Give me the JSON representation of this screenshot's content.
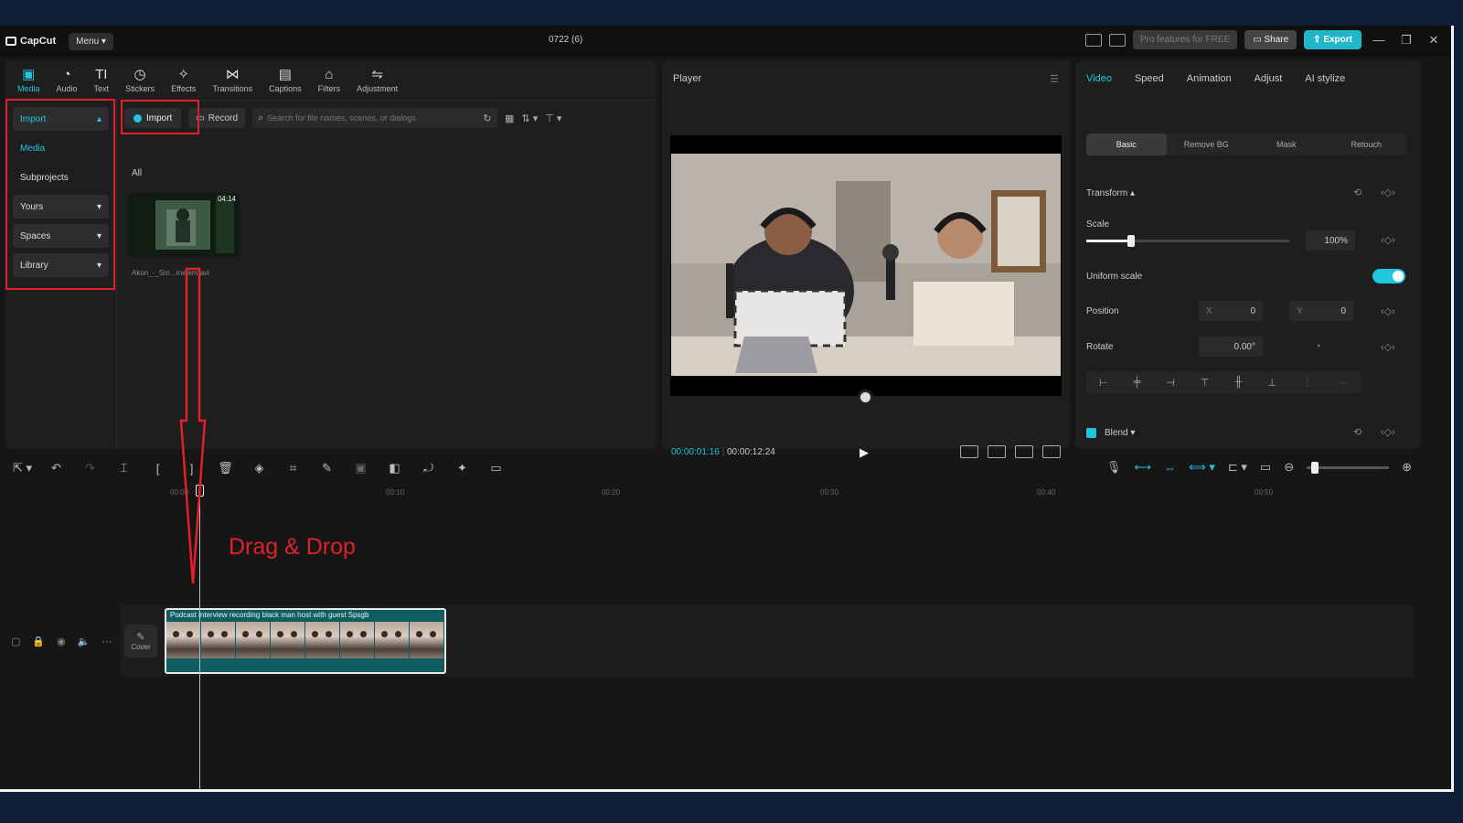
{
  "app": {
    "name": "CapCut",
    "menu_label": "Menu",
    "project_title": "0722 (6)"
  },
  "titlebar": {
    "pro_label": "Pro features for FREE",
    "share_label": "Share",
    "export_label": "Export",
    "minimize": "—",
    "maximize": "❐",
    "close": "✕"
  },
  "media_tabs": [
    {
      "label": "Media",
      "icon": "▣"
    },
    {
      "label": "Audio",
      "icon": "◔"
    },
    {
      "label": "Text",
      "icon": "TI"
    },
    {
      "label": "Stickers",
      "icon": "◷"
    },
    {
      "label": "Effects",
      "icon": "✧"
    },
    {
      "label": "Transitions",
      "icon": "⋈"
    },
    {
      "label": "Captions",
      "icon": "▤"
    },
    {
      "label": "Filters",
      "icon": "⌂"
    },
    {
      "label": "Adjustment",
      "icon": "⇋"
    }
  ],
  "sidebar": {
    "import": "Import",
    "media": "Media",
    "subprojects": "Subprojects",
    "yours": "Yours",
    "spaces": "Spaces",
    "library": "Library"
  },
  "media_toolbar": {
    "import_label": "Import",
    "record_label": "Record",
    "search_placeholder": "Search for file names, scenes, or dialogs"
  },
  "media_list": {
    "filter_label": "All",
    "items": [
      {
        "name": "Akon_-_Sm...minem.avi",
        "duration": "04:14"
      }
    ]
  },
  "player": {
    "title": "Player",
    "current_time": "00:00:01:16",
    "total_time": "00:00:12:24"
  },
  "properties": {
    "tabs": [
      "Video",
      "Speed",
      "Animation",
      "Adjust",
      "AI stylize"
    ],
    "sub_tabs": [
      "Basic",
      "Remove BG",
      "Mask",
      "Retouch"
    ],
    "transform_label": "Transform",
    "scale_label": "Scale",
    "scale_value": "100%",
    "scale_fraction": 0.22,
    "uniform_scale_label": "Uniform scale",
    "position_label": "Position",
    "position_x_label": "X",
    "position_x": "0",
    "position_y_label": "Y",
    "position_y": "0",
    "rotate_label": "Rotate",
    "rotate_value": "0.00°",
    "blend_label": "Blend"
  },
  "timeline": {
    "ticks": [
      "00:00",
      "00:10",
      "00:20",
      "00:30",
      "00:40",
      "00:50"
    ],
    "clip_title": "Podcast interview recording black man host with guest Spsgb",
    "cover_label": "Cover",
    "zoom_fraction": 0.05
  },
  "annotation": {
    "drag_text": "Drag & Drop"
  },
  "colors": {
    "accent": "#1fc7de",
    "annotation_red": "#e2202a",
    "export": "#1fb6c9"
  }
}
